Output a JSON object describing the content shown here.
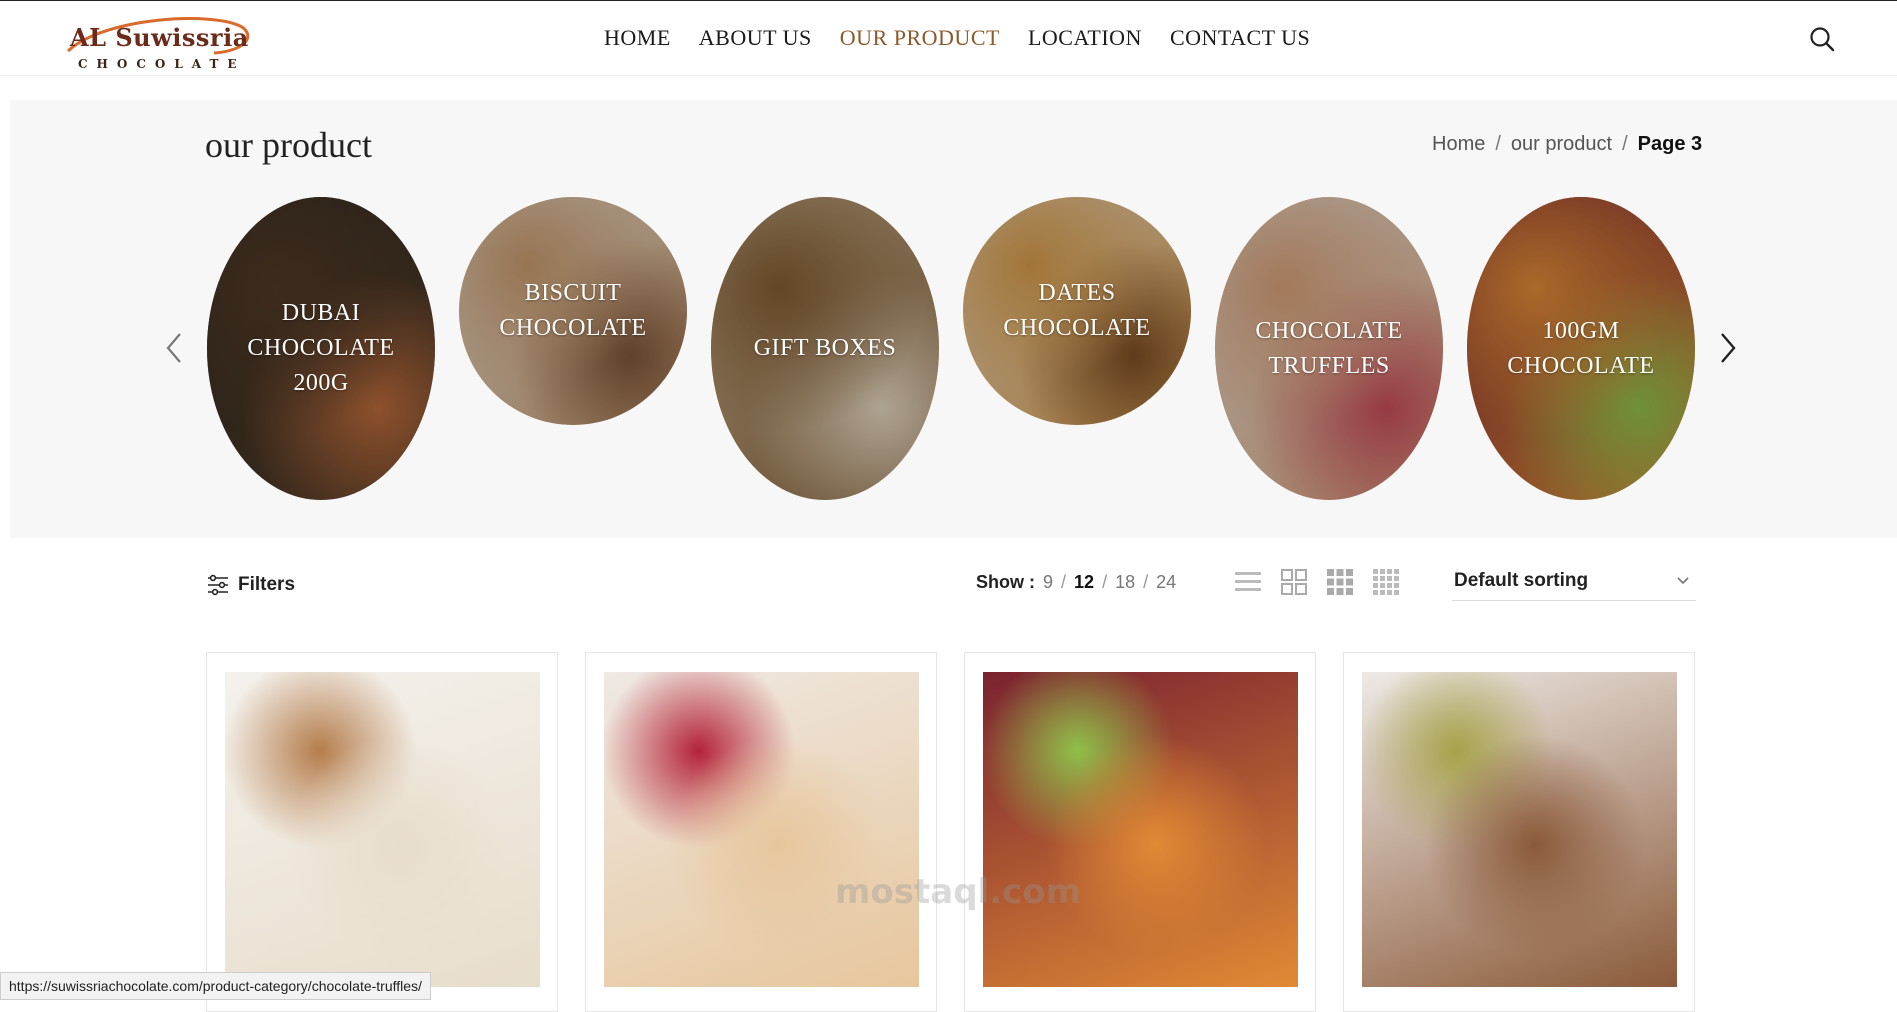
{
  "brand": {
    "name": "AL Suwissria",
    "tagline": "CHOCOLATE",
    "color_primary": "#6b2a1a",
    "color_accent": "#d86a2b"
  },
  "nav": {
    "items": [
      {
        "label": "HOME"
      },
      {
        "label": "ABOUT US"
      },
      {
        "label": "OUR PRODUCT",
        "active": true
      },
      {
        "label": "LOCATION"
      },
      {
        "label": "CONTACT US"
      }
    ],
    "active_color": "#8b5a2b",
    "search_icon": "search-icon"
  },
  "page": {
    "title": "our product",
    "breadcrumb": {
      "home": "Home",
      "separator": "/",
      "section": "our product",
      "current": "Page 3"
    }
  },
  "categories": [
    {
      "label": "DUBAI CHOCOLATE 200G",
      "colors": [
        "#2a2520",
        "#4a3424",
        "#b8683a"
      ]
    },
    {
      "label": "BISCUIT CHOCOLATE",
      "colors": [
        "#e7dcd1",
        "#c79a6f",
        "#7a5236"
      ]
    },
    {
      "label": "GIFT BOXES",
      "colors": [
        "#c9b394",
        "#7e5a33",
        "#e6dac6"
      ]
    },
    {
      "label": "DATES CHOCOLATE",
      "colors": [
        "#ead7bf",
        "#d69b4a",
        "#7a4a22"
      ]
    },
    {
      "label": "CHOCOLATE TRUFFLES",
      "colors": [
        "#e9e3dd",
        "#d7a07a",
        "#c64a5a"
      ]
    },
    {
      "label": "100GM CHOCOLATE",
      "colors": [
        "#7a2230",
        "#e08a35",
        "#8fc04a"
      ]
    }
  ],
  "toolbar": {
    "filters_label": "Filters",
    "show_label": "Show :",
    "show_options": [
      "9",
      "12",
      "18",
      "24"
    ],
    "show_active": "12",
    "sort_label": "Default sorting",
    "view_icons": [
      "list-view-icon",
      "grid-2-icon",
      "grid-3-icon",
      "grid-4-icon"
    ]
  },
  "products": [
    {
      "image": "white-chocolate-squares",
      "colors": [
        "#f4f1ec",
        "#e8ddcc",
        "#b57d4c"
      ]
    },
    {
      "image": "pink-truffle-with-roses",
      "colors": [
        "#efe9e4",
        "#e7c69c",
        "#b4233a"
      ]
    },
    {
      "image": "chocolate-bars-assortment",
      "colors": [
        "#7a2230",
        "#e08a35",
        "#8fc04a"
      ]
    },
    {
      "image": "pistachio-chocolate-rolls",
      "colors": [
        "#eeeae6",
        "#8b5a3a",
        "#a6a34a"
      ]
    }
  ],
  "status_url": "https://suwissriachocolate.com/product-category/chocolate-truffles/",
  "watermark": "mostaql.com"
}
